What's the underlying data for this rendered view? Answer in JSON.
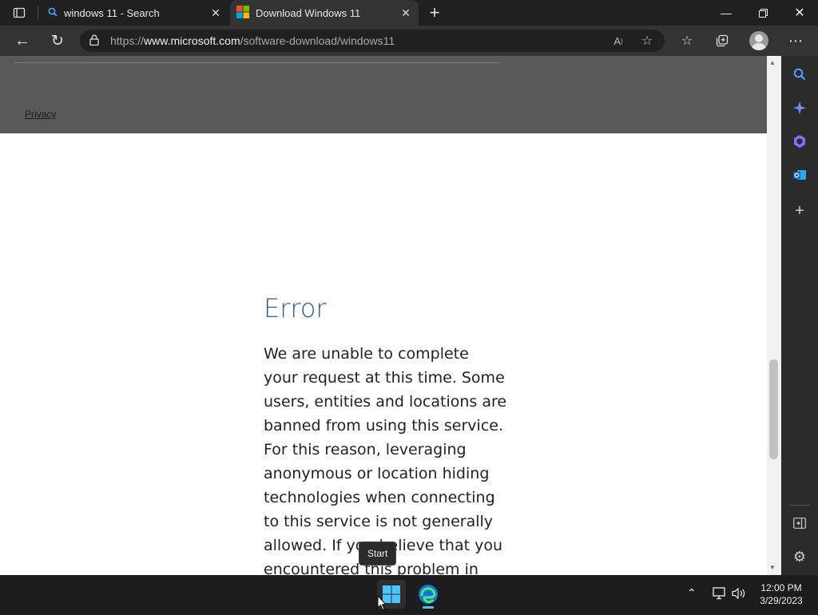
{
  "browser": {
    "tabs": [
      {
        "title": "windows 11 - Search"
      },
      {
        "title": "Download Windows 11"
      }
    ],
    "address": {
      "scheme": "https://",
      "host": "www.microsoft.com",
      "path": "/software-download/windows11"
    }
  },
  "page": {
    "privacy_link": "Privacy",
    "error_title": "Error",
    "error_body": "We are unable to complete your request at this time. Some users, entities and locations are banned from using this service. For this reason, leveraging anonymous or location hiding technologies when connecting to this service is not generally allowed. If you believe that you encountered this problem in error, please try again."
  },
  "taskbar": {
    "tooltip": "Start",
    "time": "12:00 PM",
    "date": "3/29/2023"
  },
  "colors": {
    "accent": "#2a5f91",
    "start_blue": "#4cc2ff"
  }
}
